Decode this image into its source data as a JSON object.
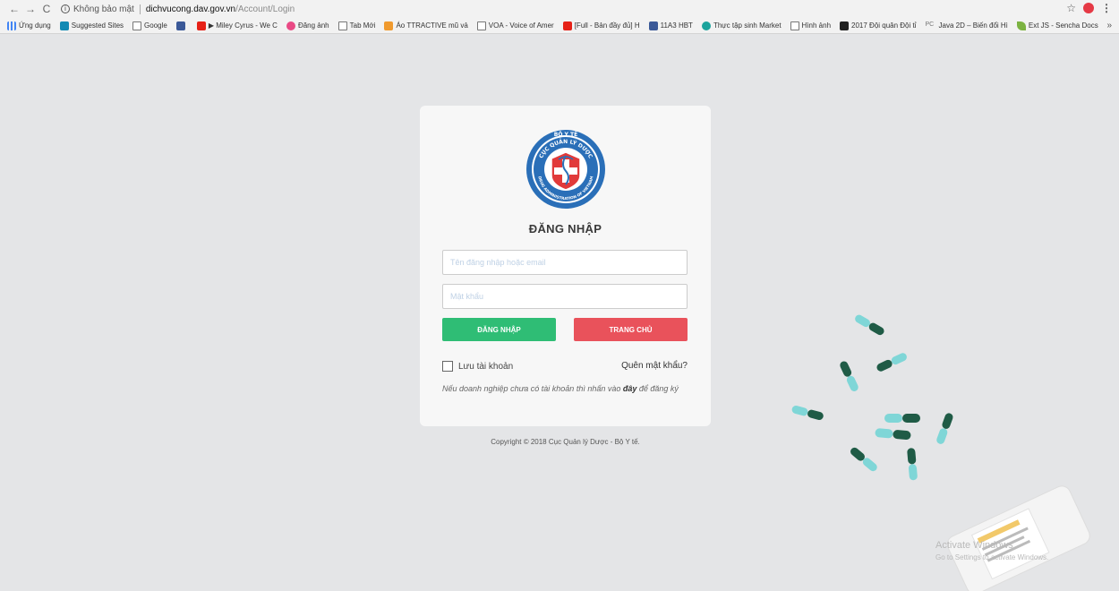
{
  "browser": {
    "security_label": "Không bảo mật",
    "url_host": "dichvucong.dav.gov.vn",
    "url_path": "/Account/Login",
    "bookmarks": [
      {
        "label": "Ứng dụng",
        "icon": "apps-icon"
      },
      {
        "label": "Suggested Sites",
        "icon": "bing-icon"
      },
      {
        "label": "Google",
        "icon": "page-icon"
      },
      {
        "label": "",
        "icon": "facebook-icon"
      },
      {
        "label": "▶ Miley Cyrus - We C",
        "icon": "youtube-icon"
      },
      {
        "label": "Đăng ảnh",
        "icon": "pink-icon"
      },
      {
        "label": "Tab Mới",
        "icon": "page-icon"
      },
      {
        "label": "Áo TTRACTIVE mũ vả",
        "icon": "orange-icon"
      },
      {
        "label": "VOA - Voice of Amer",
        "icon": "page-icon"
      },
      {
        "label": "[Full - Bản đầy đủ] H",
        "icon": "youtube-icon"
      },
      {
        "label": "11A3 HBT",
        "icon": "facebook-icon"
      },
      {
        "label": "Thực tập sinh Market",
        "icon": "teal-icon"
      },
      {
        "label": "Hình ảnh",
        "icon": "page-icon"
      },
      {
        "label": "2017 Đội quân Đội tỉ",
        "icon": "dark-icon"
      },
      {
        "label": "Java 2D – Biến đổi Hì",
        "icon": "pc-icon"
      },
      {
        "label": "Ext JS - Sencha Docs",
        "icon": "leaf-icon"
      }
    ],
    "more": "»"
  },
  "login": {
    "title": "ĐĂNG NHẬP",
    "username_placeholder": "Tên đăng nhập hoặc email",
    "password_placeholder": "Mật khẩu",
    "login_button": "ĐĂNG NHẬP",
    "home_button": "TRANG CHỦ",
    "remember_label": "Lưu tài khoản",
    "forgot_link": "Quên mật khẩu?",
    "note_prefix": "Nếu doanh nghiệp chưa có tài khoản thì nhấn vào ",
    "note_link": "đây",
    "note_suffix": " để đăng ký"
  },
  "logo": {
    "top_text": "BỘ Y TẾ",
    "ring_text": "CỤC QUẢN LÝ DƯỢC",
    "bottom_text": "DRUG ADMINISTRATION OF VIETNAM",
    "abbr": "D.A.V"
  },
  "copyright": "Copyright © 2018 Cục Quản lý Dược - Bộ Y tế.",
  "watermark": {
    "line1": "Activate Windows",
    "line2": "Go to Settings to activate Windows."
  },
  "colors": {
    "login_green": "#2fbd75",
    "home_red": "#e9525b",
    "logo_blue": "#2a6fb8"
  }
}
